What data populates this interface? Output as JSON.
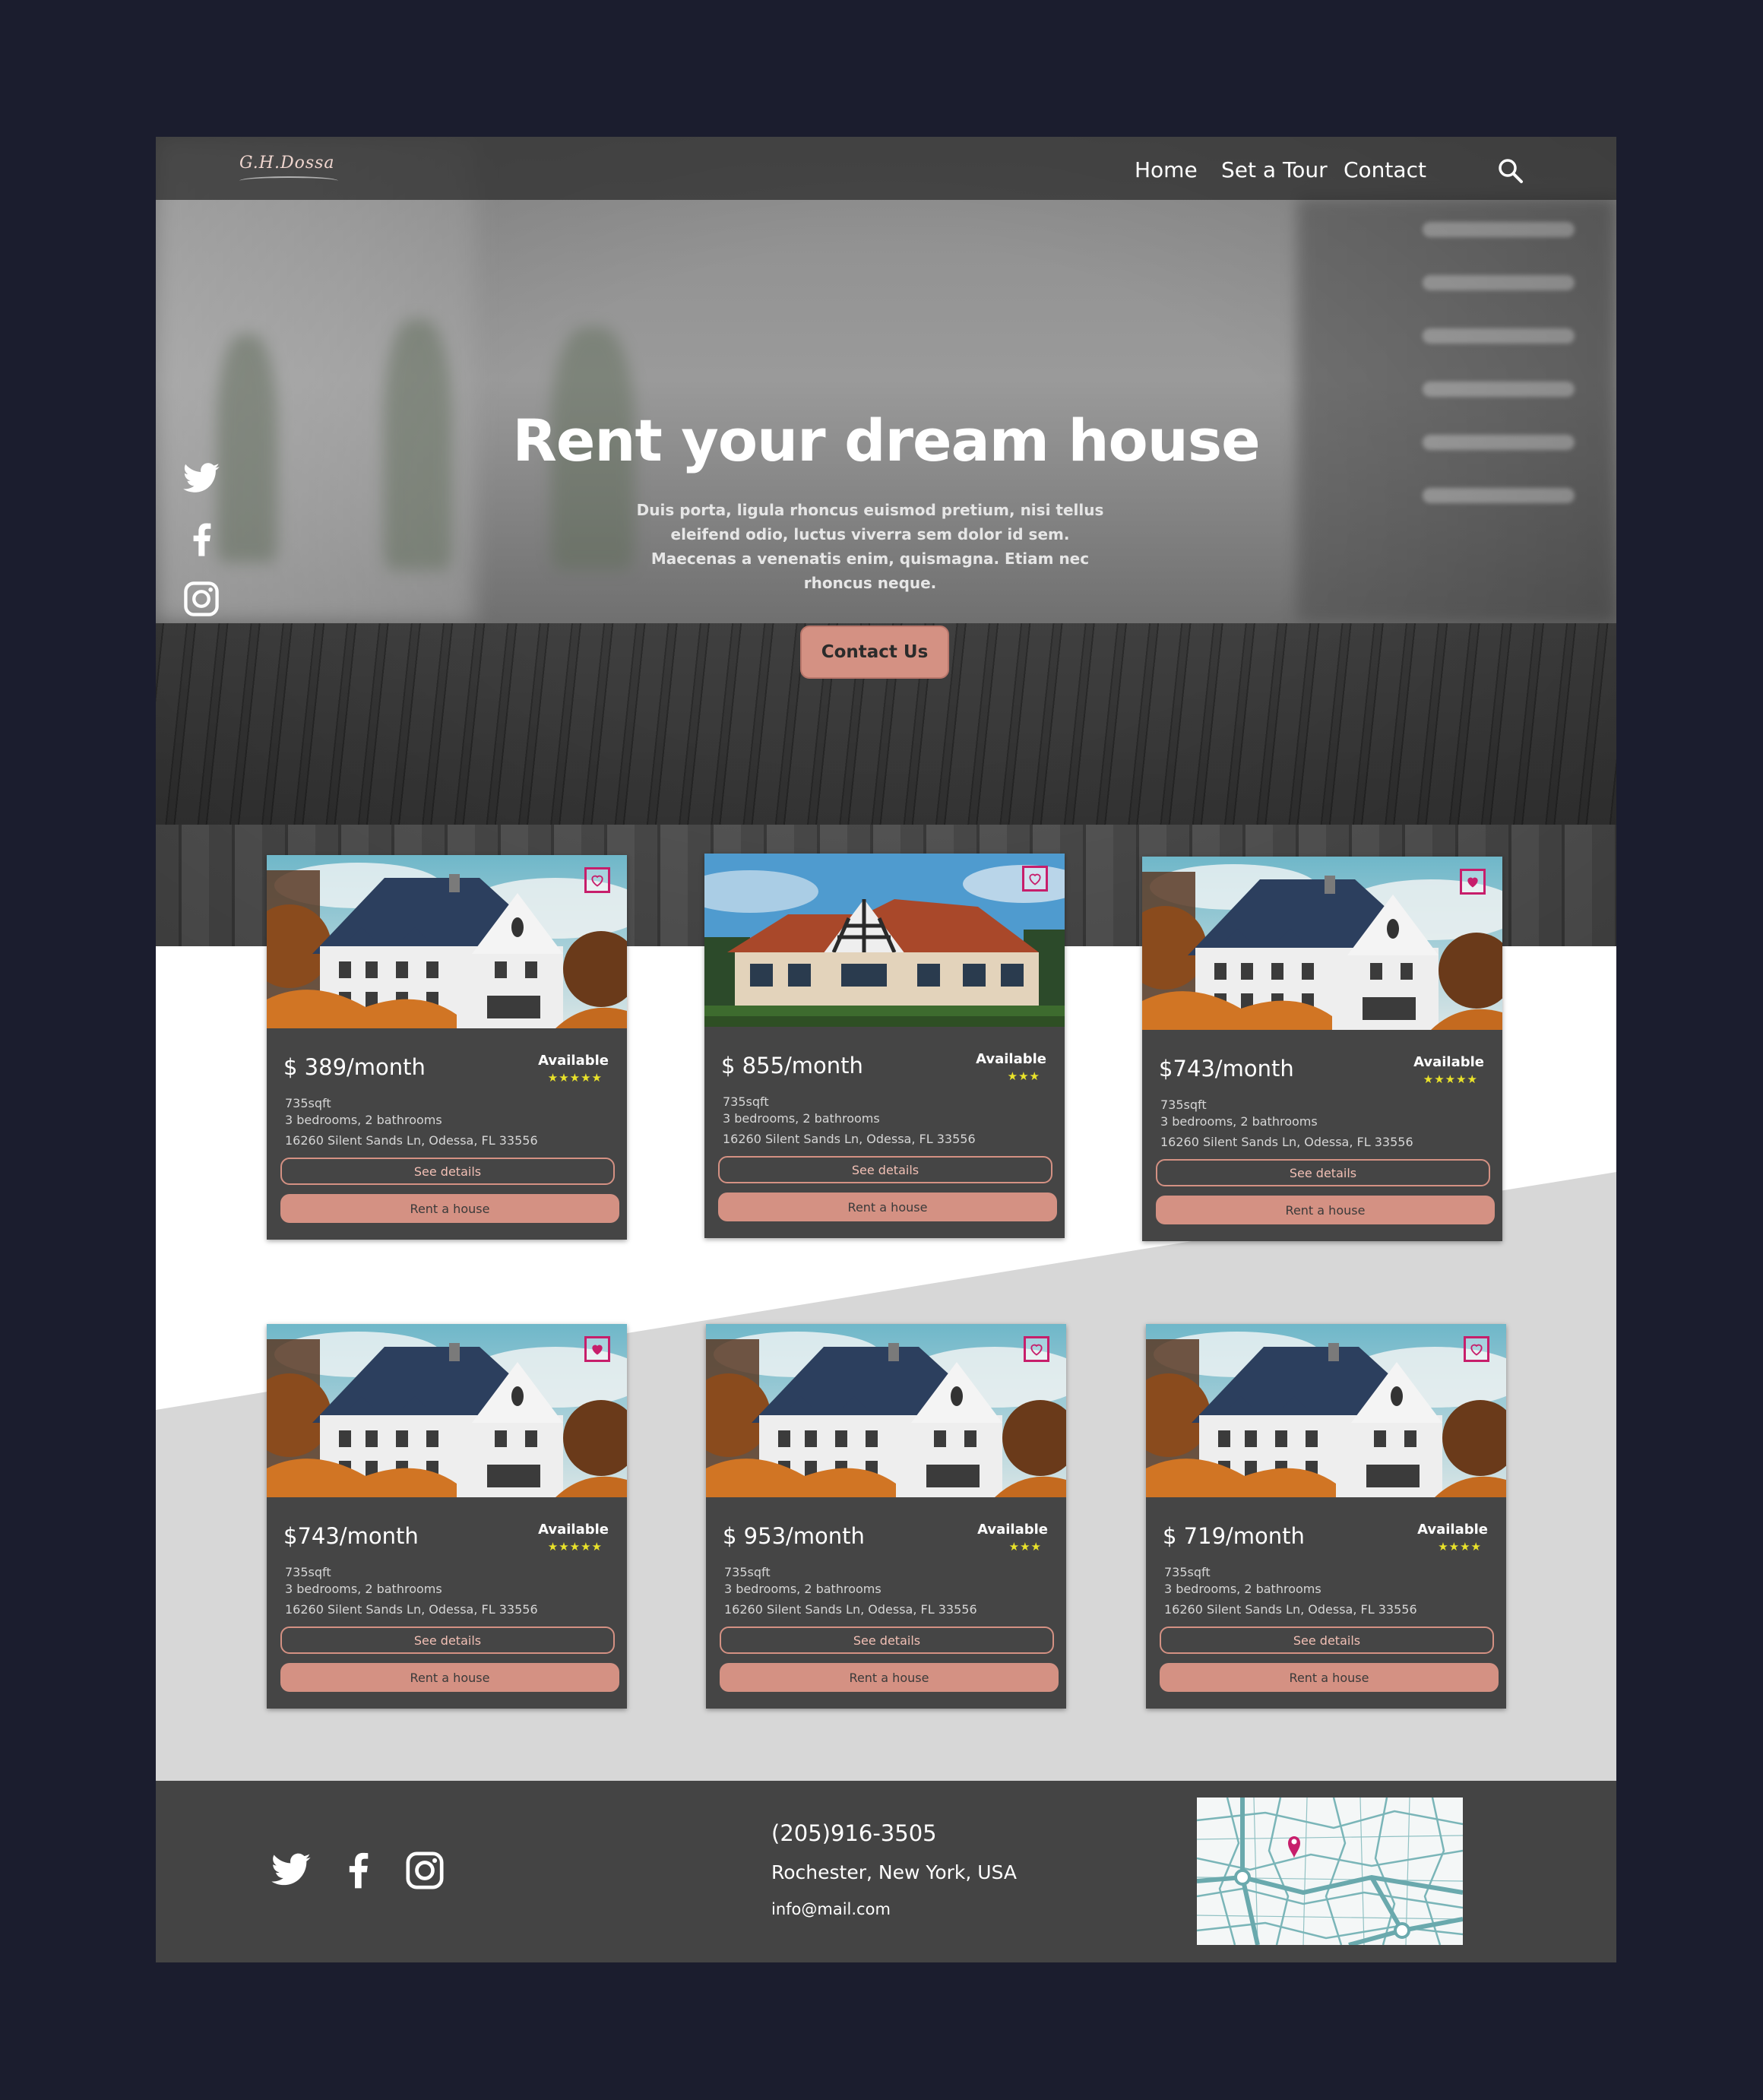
{
  "brand": {
    "logo_text": "G.H.Dossa"
  },
  "nav": {
    "items": [
      {
        "label": "Home"
      },
      {
        "label": "Set a Tour"
      },
      {
        "label": "Contact"
      }
    ]
  },
  "hero": {
    "title": "Rent your dream house",
    "description": "Duis porta, ligula rhoncus euismod pretium, nisi tellus eleifend odio, luctus viverra sem dolor id sem. Maecenas a venenatis enim, quismagna. Etiam nec rhoncus neque.",
    "cta_label": "Contact Us"
  },
  "social_icons": [
    "twitter-icon",
    "facebook-icon",
    "instagram-icon"
  ],
  "listings": [
    {
      "price": "$ 389/month",
      "status": "Available",
      "rating": 5,
      "area": "735sqft",
      "rooms": "3 bedrooms, 2 bathrooms",
      "address": "16260 Silent Sands Ln, Odessa, FL 33556",
      "details_label": "See details",
      "rent_label": "Rent a house",
      "favorited": false,
      "photo": "white-house"
    },
    {
      "price": "$ 855/month",
      "status": "Available",
      "rating": 3,
      "area": "735sqft",
      "rooms": "3 bedrooms, 2 bathrooms",
      "address": "16260 Silent Sands Ln, Odessa, FL 33556",
      "details_label": "See details",
      "rent_label": "Rent a house",
      "favorited": false,
      "photo": "tudor-house"
    },
    {
      "price": "$743/month",
      "status": "Available",
      "rating": 5,
      "area": "735sqft",
      "rooms": "3 bedrooms, 2 bathrooms",
      "address": "16260 Silent Sands Ln, Odessa, FL 33556",
      "details_label": "See details",
      "rent_label": "Rent a house",
      "favorited": true,
      "photo": "white-house"
    },
    {
      "price": "$743/month",
      "status": "Available",
      "rating": 5,
      "area": "735sqft",
      "rooms": "3 bedrooms, 2 bathrooms",
      "address": "16260 Silent Sands Ln, Odessa, FL 33556",
      "details_label": "See details",
      "rent_label": "Rent a house",
      "favorited": true,
      "photo": "white-house"
    },
    {
      "price": "$ 953/month",
      "status": "Available",
      "rating": 3,
      "area": "735sqft",
      "rooms": "3 bedrooms, 2 bathrooms",
      "address": "16260 Silent Sands Ln, Odessa, FL 33556",
      "details_label": "See details",
      "rent_label": "Rent a house",
      "favorited": false,
      "photo": "white-house"
    },
    {
      "price": "$ 719/month",
      "status": "Available",
      "rating": 4,
      "area": "735sqft",
      "rooms": "3 bedrooms, 2 bathrooms",
      "address": "16260 Silent Sands Ln, Odessa, FL 33556",
      "details_label": "See details",
      "rent_label": "Rent a house",
      "favorited": false,
      "photo": "white-house"
    }
  ],
  "footer": {
    "phone": "(205)916-3505",
    "address": "Rochester, New York, USA",
    "email": "info@mail.com"
  },
  "colors": {
    "background": "#1b1d2e",
    "accent": "#d49183",
    "card": "#454545",
    "heart": "#c71e6b",
    "stars": "#e9e22a",
    "footer": "#444444",
    "band": "#d7d7d7"
  }
}
